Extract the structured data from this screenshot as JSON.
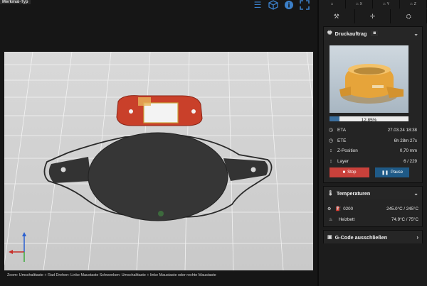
{
  "viewer": {
    "feature_tag": "Merkmal-Typ",
    "footer_text": "Zoom: Umschalttaste + Rad Drehen: Linke Maustaste Schwenken: Umschalttaste + linke Maustaste oder rechte Maustaste",
    "tool_icons": [
      "list-icon",
      "cube-icon",
      "info-icon",
      "fullscreen-icon"
    ]
  },
  "panel": {
    "tabs": [
      {
        "icon": "home-icon",
        "label": ""
      },
      {
        "icon": "home-x-icon",
        "label": "X"
      },
      {
        "icon": "home-y-icon",
        "label": "Y"
      },
      {
        "icon": "home-z-icon",
        "label": "Z"
      }
    ],
    "tool_icons": [
      "tools-icon",
      "axes-icon",
      "extruder-icon"
    ],
    "job": {
      "title": "Druckauftrag",
      "progress_percent": 12.85,
      "progress_label": "12,85%",
      "rows": [
        {
          "icon": "clock-icon",
          "label": "ETA",
          "value": "27.03.24 18:38"
        },
        {
          "icon": "clock-icon",
          "label": "ETE",
          "value": "6h 28m 27s"
        },
        {
          "icon": "z-position-icon",
          "label": "Z-Position",
          "value": "0,70 mm"
        },
        {
          "icon": "layer-icon",
          "label": "Layer",
          "value": "6 / 229"
        }
      ],
      "stop_label": "Stop",
      "pause_label": "Pause"
    },
    "temperatures": {
      "title": "Temperaturen",
      "rows": [
        {
          "icon": "extruder-icon",
          "label": "0200",
          "value": "245.0°C / 245°C"
        },
        {
          "icon": "heatbed-icon",
          "label": "Heizbett",
          "value": "74.9°C / 75°C"
        }
      ]
    },
    "gcode": {
      "title": "G-Code ausschließen"
    }
  },
  "colors": {
    "accent": "#3b7fc8",
    "stop": "#c9413b",
    "pause": "#1f5a87",
    "progress": "#3b6f9e"
  }
}
